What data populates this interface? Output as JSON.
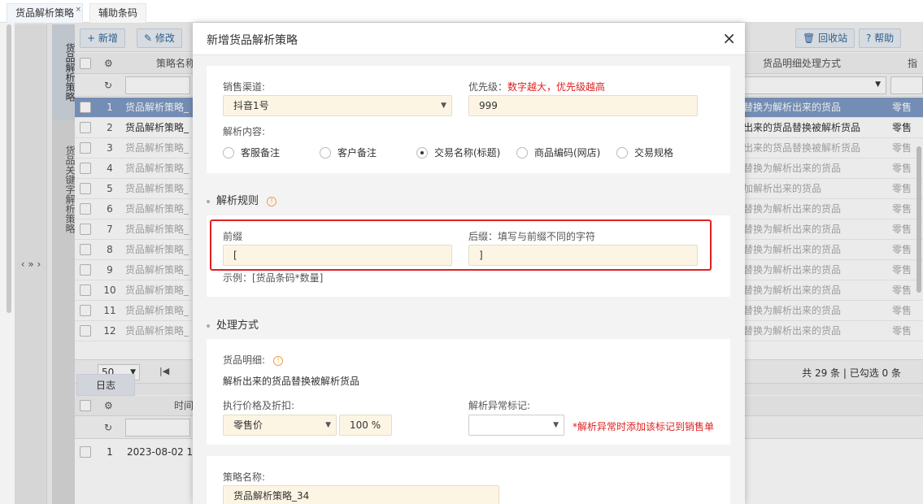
{
  "tabs": [
    {
      "label": "货品解析策略",
      "close": "×"
    },
    {
      "label": "辅助条码"
    }
  ],
  "collapse": {
    "arrows": "‹ » ›"
  },
  "side_tabs": [
    {
      "label": "货品解析策略"
    },
    {
      "label": "货品关键字解析策略"
    }
  ],
  "toolbar": {
    "add_label": "+ 新增",
    "edit_label": "修改",
    "recycle_label": "回收站",
    "help_label": "? 帮助"
  },
  "grid": {
    "col_name": "策略名称",
    "col_process": "货品明细处理方式",
    "col_last": "指",
    "rows": [
      {
        "num": "1",
        "name": "货品解析策略_",
        "proc": "替换为解析出来的货品",
        "retail": "零售"
      },
      {
        "num": "2",
        "name": "货品解析策略_",
        "proc": "出来的货品替换被解析货品",
        "retail": "零售"
      },
      {
        "num": "3",
        "name": "货品解析策略_",
        "proc": "出来的货品替换被解析货品",
        "retail": "零售"
      },
      {
        "num": "4",
        "name": "货品解析策略_",
        "proc": "替换为解析出来的货品",
        "retail": "零售"
      },
      {
        "num": "5",
        "name": "货品解析策略_",
        "proc": "加解析出来的货品",
        "retail": "零售"
      },
      {
        "num": "6",
        "name": "货品解析策略_",
        "proc": "替换为解析出来的货品",
        "retail": "零售"
      },
      {
        "num": "7",
        "name": "货品解析策略_",
        "proc": "替换为解析出来的货品",
        "retail": "零售"
      },
      {
        "num": "8",
        "name": "货品解析策略_",
        "proc": "替换为解析出来的货品",
        "retail": "零售"
      },
      {
        "num": "9",
        "name": "货品解析策略_",
        "proc": "替换为解析出来的货品",
        "retail": "零售"
      },
      {
        "num": "10",
        "name": "货品解析策略_",
        "proc": "替换为解析出来的货品",
        "retail": "零售"
      },
      {
        "num": "11",
        "name": "货品解析策略_",
        "proc": "替换为解析出来的货品",
        "retail": "零售"
      },
      {
        "num": "12",
        "name": "货品解析策略_",
        "proc": "替换为解析出来的货品",
        "retail": "零售"
      }
    ]
  },
  "pager": {
    "page_size": "50",
    "summary": "共 29 条 | 已勾选 0 条"
  },
  "log": {
    "tab_label": "日志",
    "col_time": "时间",
    "row_num": "1",
    "row_time": "2023-08-02 1("
  },
  "modal": {
    "title": "新增货品解析策略",
    "close": "×",
    "channel_label": "销售渠道:",
    "channel_value": "抖音1号",
    "priority_label": "优先级：",
    "priority_hint": "数字越大，优先级越高",
    "priority_value": "999",
    "parse_content_label": "解析内容:",
    "parse_options": [
      {
        "label": "客服备注",
        "checked": false
      },
      {
        "label": "客户备注",
        "checked": false
      },
      {
        "label": "交易名称(标题)",
        "checked": true
      },
      {
        "label": "商品编码(网店)",
        "checked": false
      },
      {
        "label": "交易规格",
        "checked": false
      }
    ],
    "rule_section": "解析规则",
    "prefix_label": "前缀",
    "prefix_value": "[",
    "suffix_label": "后缀：填写与前缀不同的字符",
    "suffix_value": "]",
    "example": "示例：[货品条码*数量]",
    "process_section": "处理方式",
    "detail_label": "货品明细:",
    "detail_value": "解析出来的货品替换被解析货品",
    "price_label": "执行价格及折扣:",
    "price_value": "零售价",
    "discount_value": "100 %",
    "abnormal_label": "解析异常标记:",
    "abnormal_hint": "*解析异常时添加该标记到销售单",
    "strategy_name_label": "策略名称:",
    "strategy_name_value": "货品解析策略_34"
  },
  "colors": {
    "accent_red": "#e02020",
    "selected_row": "#7e99c4",
    "field_bg": "#fdf5e4"
  }
}
